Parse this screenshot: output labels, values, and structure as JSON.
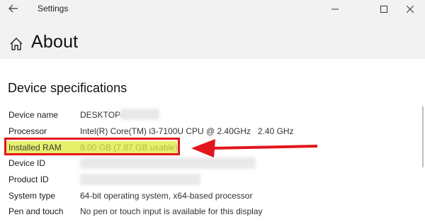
{
  "window": {
    "app_title": "Settings"
  },
  "header": {
    "title": "About"
  },
  "specs": {
    "section_title": "Device specifications",
    "rows": [
      {
        "label": "Device name",
        "value": "DESKTOP-"
      },
      {
        "label": "Processor",
        "value": "Intel(R) Core(TM) i3-7100U CPU @ 2.40GHz   2.40 GHz"
      },
      {
        "label": "Installed RAM",
        "value": "8.00 GB (7.87 GB usable)"
      },
      {
        "label": "Device ID",
        "value": ""
      },
      {
        "label": "Product ID",
        "value": ""
      },
      {
        "label": "System type",
        "value": "64-bit operating system, x64-based processor"
      },
      {
        "label": "Pen and touch",
        "value": "No pen or touch input is available for this display"
      }
    ]
  },
  "annotation": {
    "highlight_color": "#e7f06b",
    "box_color": "#e3151d",
    "arrow_color": "#e3151d"
  },
  "icons": {
    "back": "back-arrow-icon",
    "minimize": "minimize-icon",
    "maximize": "maximize-icon",
    "close": "close-icon",
    "home": "home-icon"
  }
}
